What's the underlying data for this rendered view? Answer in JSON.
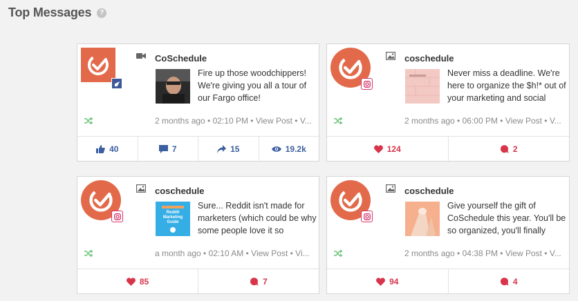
{
  "header": {
    "title": "Top Messages",
    "help_glyph": "?"
  },
  "cards": [
    {
      "network": "facebook",
      "account": "CoSchedule",
      "media_type": "video-icon",
      "text": "Fire up those woodchippers! We're giving you all a tour of our Fargo office!",
      "time": "2 months ago • 02:10 PM • ",
      "view_post": "View Post",
      "more": " • V...",
      "stats": [
        {
          "icon": "thumbs-up-icon",
          "value": "40"
        },
        {
          "icon": "comment-icon",
          "value": "7"
        },
        {
          "icon": "share-icon",
          "value": "15"
        },
        {
          "icon": "eye-icon",
          "value": "19.2k"
        }
      ]
    },
    {
      "network": "instagram",
      "account": "coschedule",
      "media_type": "image-icon",
      "text": "Never miss a deadline. We're here to organize the $h!* out of your marketing and social",
      "time": "2 months ago • 06:00 PM • ",
      "view_post": "View Post",
      "more": " • V...",
      "stats": [
        {
          "icon": "heart-icon",
          "value": "124"
        },
        {
          "icon": "comment-icon",
          "value": "2"
        }
      ]
    },
    {
      "network": "instagram",
      "account": "coschedule",
      "media_type": "image-icon",
      "text": "Sure... Reddit isn't made for marketers (which could be why some people love it so",
      "time": "a month ago • 02:10 AM • ",
      "view_post": "View Post",
      "more": " • Vi...",
      "thumb_text": "Reddit Marketing Guide",
      "stats": [
        {
          "icon": "heart-icon",
          "value": "85"
        },
        {
          "icon": "comment-icon",
          "value": "7"
        }
      ]
    },
    {
      "network": "instagram",
      "account": "coschedule",
      "media_type": "image-icon",
      "text": "Give yourself the gift of CoSchedule this year. You'll be so organized, you'll finally",
      "time": "2 months ago • 04:38 PM • ",
      "view_post": "View Post",
      "more": " • V...",
      "stats": [
        {
          "icon": "heart-icon",
          "value": "94"
        },
        {
          "icon": "comment-icon",
          "value": "4"
        }
      ]
    }
  ],
  "colors": {
    "brand": "#e26a4b",
    "facebook": "#3b5f9f",
    "instagram": "#d8344a",
    "shuffle": "#6cc47a"
  }
}
